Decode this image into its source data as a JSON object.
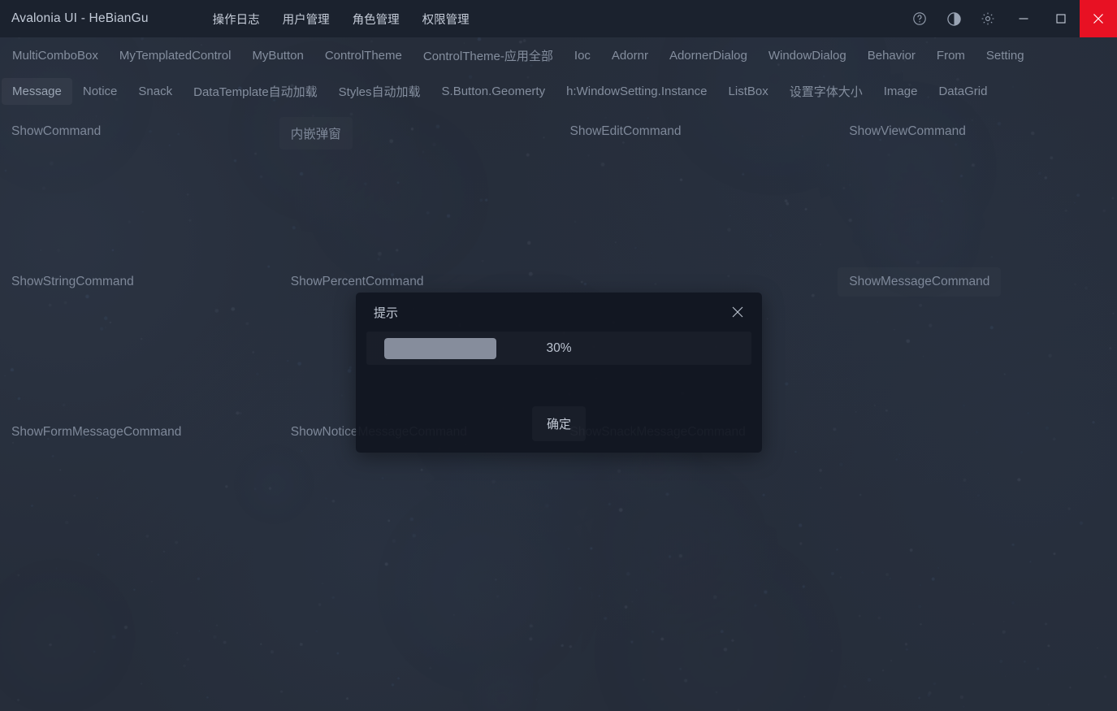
{
  "window": {
    "title": "Avalonia UI - HeBianGu",
    "menu": [
      "操作日志",
      "用户管理",
      "角色管理",
      "权限管理"
    ],
    "icons": {
      "help": "help-circle-icon",
      "theme": "theme-contrast-icon",
      "settings": "gear-icon",
      "minimize": "minimize-icon",
      "maximize": "maximize-icon",
      "close": "close-icon"
    },
    "accent_close": "#e81123",
    "titlebar_bg": "#1b222e",
    "page_bg": "#262d3a"
  },
  "tabs_row1": [
    {
      "label": "MultiComboBox",
      "selected": false
    },
    {
      "label": "MyTemplatedControl",
      "selected": false
    },
    {
      "label": "MyButton",
      "selected": false
    },
    {
      "label": "ControlTheme",
      "selected": false
    },
    {
      "label": "ControlTheme-应用全部",
      "selected": false
    },
    {
      "label": "Ioc",
      "selected": false
    },
    {
      "label": "Adornr",
      "selected": false
    },
    {
      "label": "AdornerDialog",
      "selected": false
    },
    {
      "label": "WindowDialog",
      "selected": false
    },
    {
      "label": "Behavior",
      "selected": false
    },
    {
      "label": "From",
      "selected": false
    },
    {
      "label": "Setting",
      "selected": false
    }
  ],
  "tabs_row2": [
    {
      "label": "Message",
      "selected": true
    },
    {
      "label": "Notice",
      "selected": false
    },
    {
      "label": "Snack",
      "selected": false
    },
    {
      "label": "DataTemplate自动加载",
      "selected": false
    },
    {
      "label": "Styles自动加载",
      "selected": false
    },
    {
      "label": "S.Button.Geomerty",
      "selected": false
    },
    {
      "label": "h:WindowSetting.Instance",
      "selected": false
    },
    {
      "label": "ListBox",
      "selected": false
    },
    {
      "label": "设置字体大小",
      "selected": false
    },
    {
      "label": "Image",
      "selected": false
    },
    {
      "label": "DataGrid",
      "selected": false
    }
  ],
  "commands": {
    "row1": [
      "ShowCommand",
      "内嵌弹窗",
      "ShowEditCommand",
      "ShowViewCommand"
    ],
    "row2": [
      "ShowStringCommand",
      "ShowPercentCommand",
      "",
      "ShowMessageCommand"
    ],
    "row3": [
      "ShowFormMessageCommand",
      "ShowNoticeMessageCommand",
      "ShowSnackMessageCommand",
      ""
    ]
  },
  "dialog": {
    "title": "提示",
    "close_icon": "close-icon",
    "progress_value": "30%",
    "progress_percent": 30,
    "ok_label": "确定",
    "fill_color": "#868d9c"
  }
}
